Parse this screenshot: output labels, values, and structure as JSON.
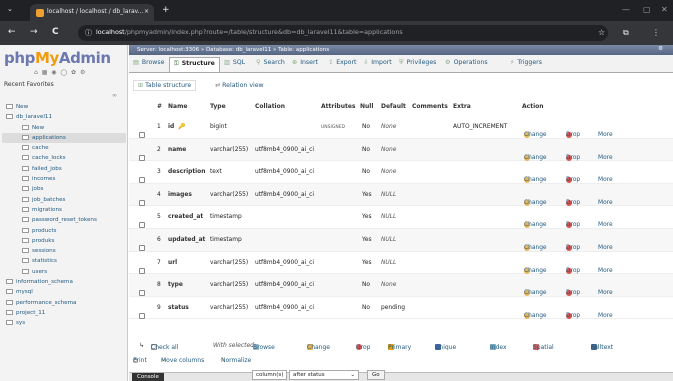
{
  "browser": {
    "tab_title": "localhost / localhost / db_larav...",
    "tab_close": "×",
    "new_tab": "+",
    "url_host": "localhost",
    "url_path": "/phpmyadmin/index.php?route=/table/structure&db=db_laravel11&table=applications",
    "back": "←",
    "forward": "→",
    "reload": "C",
    "chevron": "⌄",
    "star": "☆",
    "ext": "⧉",
    "menu": "⋮",
    "minimize": "—",
    "maximize": "▢",
    "close": "✕"
  },
  "sidebar": {
    "logo_php": "php",
    "logo_my": "My",
    "logo_admin": "Admin",
    "logo_icons": "⌂ ▦ ◉ ◯ ✿ ⚙",
    "tabs": "Recent   Favorites",
    "tree": [
      {
        "label": "New",
        "indent": 0
      },
      {
        "label": "db_laravel11",
        "indent": 0
      },
      {
        "label": "New",
        "indent": 1
      },
      {
        "label": "applications",
        "indent": 1,
        "selected": true
      },
      {
        "label": "cache",
        "indent": 1
      },
      {
        "label": "cache_locks",
        "indent": 1
      },
      {
        "label": "failed_jobs",
        "indent": 1
      },
      {
        "label": "incomes",
        "indent": 1
      },
      {
        "label": "jobs",
        "indent": 1
      },
      {
        "label": "job_batches",
        "indent": 1
      },
      {
        "label": "migrations",
        "indent": 1
      },
      {
        "label": "password_reset_tokens",
        "indent": 1
      },
      {
        "label": "products",
        "indent": 1
      },
      {
        "label": "produks",
        "indent": 1
      },
      {
        "label": "sessions",
        "indent": 1
      },
      {
        "label": "statistics",
        "indent": 1
      },
      {
        "label": "users",
        "indent": 1
      },
      {
        "label": "information_schema",
        "indent": 0
      },
      {
        "label": "mysql",
        "indent": 0
      },
      {
        "label": "performance_schema",
        "indent": 0
      },
      {
        "label": "project_11",
        "indent": 0
      },
      {
        "label": "sys",
        "indent": 0
      }
    ]
  },
  "breadcrumb": "Server: localhost:3306  »  Database: db_laravel11  »  Table: applications",
  "main_tabs": [
    "Browse",
    "Structure",
    "SQL",
    "Search",
    "Insert",
    "Export",
    "Import",
    "Privileges",
    "Operations",
    "Triggers"
  ],
  "sub_tabs": [
    "Table structure",
    "Relation view"
  ],
  "columns": [
    "#",
    "Name",
    "Type",
    "Collation",
    "Attributes",
    "Null",
    "Default",
    "Comments",
    "Extra",
    "Action"
  ],
  "rows": [
    {
      "num": "1",
      "name": "id",
      "type": "bigint",
      "collation": "",
      "attributes": "UNSIGNED",
      "null": "No",
      "default": "None",
      "extra": "AUTO_INCREMENT"
    },
    {
      "num": "2",
      "name": "name",
      "type": "varchar(255)",
      "collation": "utf8mb4_0900_ai_ci",
      "attributes": "",
      "null": "No",
      "default": "None",
      "extra": ""
    },
    {
      "num": "3",
      "name": "description",
      "type": "text",
      "collation": "utf8mb4_0900_ai_ci",
      "attributes": "",
      "null": "No",
      "default": "None",
      "extra": ""
    },
    {
      "num": "4",
      "name": "images",
      "type": "varchar(255)",
      "collation": "utf8mb4_0900_ai_ci",
      "attributes": "",
      "null": "Yes",
      "default": "NULL",
      "extra": ""
    },
    {
      "num": "5",
      "name": "created_at",
      "type": "timestamp",
      "collation": "",
      "attributes": "",
      "null": "Yes",
      "default": "NULL",
      "extra": ""
    },
    {
      "num": "6",
      "name": "updated_at",
      "type": "timestamp",
      "collation": "",
      "attributes": "",
      "null": "Yes",
      "default": "NULL",
      "extra": ""
    },
    {
      "num": "7",
      "name": "url",
      "type": "varchar(255)",
      "collation": "utf8mb4_0900_ai_ci",
      "attributes": "",
      "null": "Yes",
      "default": "NULL",
      "extra": ""
    },
    {
      "num": "8",
      "name": "type",
      "type": "varchar(255)",
      "collation": "utf8mb4_0900_ai_ci",
      "attributes": "",
      "null": "No",
      "default": "None",
      "extra": ""
    },
    {
      "num": "9",
      "name": "status",
      "type": "varchar(255)",
      "collation": "utf8mb4_0900_ai_ci",
      "attributes": "",
      "null": "No",
      "default": "pending",
      "extra": ""
    }
  ],
  "row_actions": {
    "change": "Change",
    "drop": "Drop",
    "more": "More"
  },
  "bulk": {
    "check_all": "Check all",
    "with_selected": "With selected:",
    "browse": "Browse",
    "change": "Change",
    "drop": "Drop",
    "primary": "Primary",
    "unique": "Unique",
    "index": "Index",
    "spatial": "Spatial",
    "fulltext": "Fulltext"
  },
  "footer": {
    "print": "Print",
    "move_columns": "Move columns",
    "normalize": "Normalize"
  },
  "console": {
    "label": "Console",
    "select1": "column(s)",
    "select2": "after status",
    "go": "Go"
  },
  "colors": {
    "accent": "#235a81",
    "drop": "#d9534f",
    "logo_blue": "#6c78af",
    "logo_orange": "#f29b0d"
  }
}
